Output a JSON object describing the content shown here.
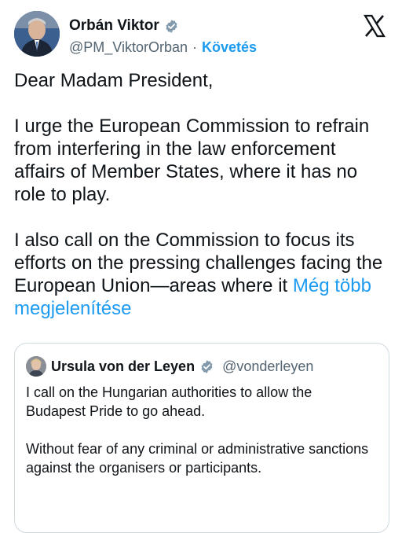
{
  "author": {
    "name": "Orbán Viktor",
    "handle": "@PM_ViktorOrban",
    "separator": "·",
    "follow_label": "Követés"
  },
  "icons": {
    "verified": "verified-badge-icon",
    "logo": "x-logo-icon"
  },
  "colors": {
    "accent": "#1d9bf0",
    "text": "#0f1419",
    "muted": "#536471",
    "border": "#cfd9de"
  },
  "tweet": {
    "line1": "Dear Madam President,",
    "paragraph2": "I urge the European Commission to refrain from interfering in the law enforcement affairs of Member States, where it has no role to play.",
    "paragraph3": "I also call on the Commission to focus its efforts on the pressing challenges facing the European Union—areas where it",
    "show_more": "Még több megjelenítése"
  },
  "quote": {
    "name": "Ursula von der Leyen",
    "handle": "@vonderleyen",
    "paragraph1": "I call on the Hungarian authorities to allow the Budapest Pride to go ahead.",
    "paragraph2": "Without fear of any criminal or administrative sanctions against the organisers or participants."
  }
}
